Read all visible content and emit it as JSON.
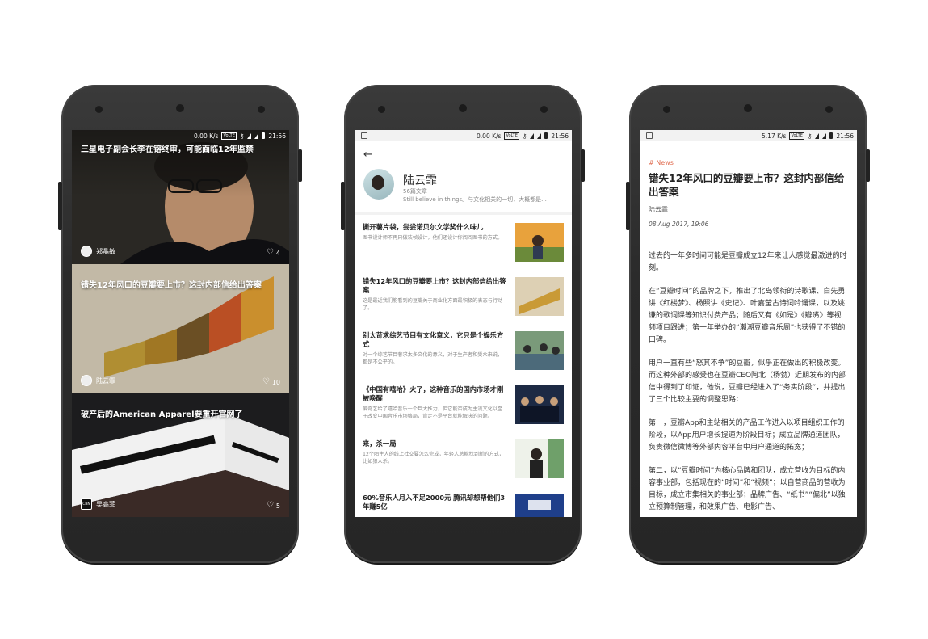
{
  "phone1": {
    "status": {
      "speed": "0.00 K/s",
      "network": "VoLTE",
      "time": "21:56"
    },
    "cards": [
      {
        "title": "三星电子副会长李在镕终审，可能面临12年监禁",
        "author": "郑晶敏",
        "likes": "4"
      },
      {
        "title": "错失12年风口的豆瓣要上市？这封内部信给出答案",
        "author": "陆云霏",
        "likes": "10"
      },
      {
        "title": "破产后的American Apparel要重开官网了",
        "author": "吴高菲",
        "likes": "5",
        "source_logo": "CBN"
      }
    ]
  },
  "phone2": {
    "status": {
      "speed": "0.00 K/s",
      "network": "VoLTE",
      "time": "21:56"
    },
    "profile": {
      "name": "陆云霏",
      "count": "56篇文章",
      "bio": "Still believe in things。与文化相关的一切，大概都是..."
    },
    "articles": [
      {
        "title": "撕开薯片袋，尝尝诺贝尔文学奖什么味儿",
        "desc": "图书设计师不再只做装帧设计，他们还设计你阅阅图书的方式。"
      },
      {
        "title": "错失12年风口的豆瓣要上市？这封内部信给出答案",
        "desc": "这是最近我们能看到的豆瓣关于商业化方面最积极的表态与行动了。"
      },
      {
        "title": "别太苛求综艺节目有文化意义，它只是个娱乐方式",
        "desc": "对一个综艺节目奢求太多文化的意义，对于生产者和受众来说，都是不公平的。"
      },
      {
        "title": "《中国有嘻哈》火了，这种音乐的国内市场才刚被唤醒",
        "desc": "爱奇艺给了嘻哈音乐一个巨大推力，但它能否成为主流文化以至于改变中国音乐市场格局，肯定不是平台就能解决的问题。"
      },
      {
        "title": "来，杀一局",
        "desc": "12个陌生人的线上社交要怎么完成，年轻人总能找到新的方式，比如狼人杀。"
      },
      {
        "title": "60%音乐人月入不足2000元 腾讯却想帮他们3年赚5亿",
        "desc": ""
      }
    ]
  },
  "phone3": {
    "status": {
      "speed": "5.17 K/s",
      "network": "VoLTE",
      "time": "21:56"
    },
    "tag": "# News",
    "title": "错失12年风口的豆瓣要上市？这封内部信给出答案",
    "author": "陆云霏",
    "date": "08 Aug 2017, 19:06",
    "paragraphs": [
      "过去的一年多时间可能是豆瓣成立12年来让人感觉最激进的时刻。",
      "在“豆瓣时间”的品牌之下，推出了北岛领衔的诗歌课、白先勇讲《红楼梦》、杨照讲《史记》、叶嘉莹古诗词吟诵课，以及姚谦的歌词课等知识付费产品；随后又有《如是》《瓣嘴》等视频项目跟进；第一年举办的“潮潮豆瓣音乐周”也获得了不错的口碑。",
      "用户一直有些“怒其不争”的豆瓣，似乎正在做出的积极改变。而这种外部的感受也在豆瓣CEO阿北（杨勃）近期发布的内部信中得到了印证，他说，豆瓣已经进入了“务实阶段”，并提出了三个比较主要的调整思路：",
      "第一，豆瓣App和主站相关的产品工作进入以项目组织工作的阶段，以App用户增长提速为阶段目标；成立品牌通道团队，负责微信微博等外部内容平台中用户通道的拓宽；",
      "第二，以“豆瓣时间”为核心品牌和团队，成立营收为目标的内容事业部，包括现在的“时间”和“视频”；以自营商品的营收为目标，成立市集相关的事业部；品牌广告、“纸书”“偏北”以独立预算制管理，和效果广告、电影广告、"
    ]
  }
}
